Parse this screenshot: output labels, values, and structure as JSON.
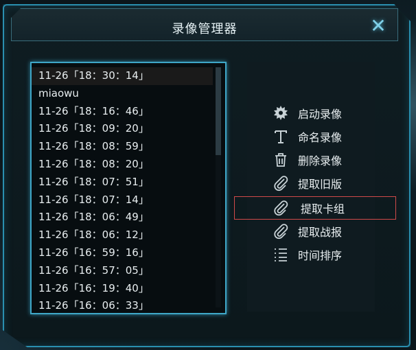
{
  "window": {
    "title": "录像管理器"
  },
  "list": {
    "items": [
      "11-26「18：30：14」",
      "miaowu",
      "11-26「18：16：46」",
      "11-26「18：09：20」",
      "11-26「18：08：59」",
      "11-26「18：08：20」",
      "11-26「18：07：51」",
      "11-26「18：07：14」",
      "11-26「18：06：49」",
      "11-26「18：06：12」",
      "11-26「16：59：16」",
      "11-26「16：57：05」",
      "11-26「16：19：40」",
      "11-26「16：06：33」"
    ],
    "selected_index": 0
  },
  "actions": [
    {
      "label": "启动录像",
      "icon": "gear-icon"
    },
    {
      "label": "命名录像",
      "icon": "text-icon"
    },
    {
      "label": "删除录像",
      "icon": "trash-icon"
    },
    {
      "label": "提取旧版",
      "icon": "paperclip-icon"
    },
    {
      "label": "提取卡组",
      "icon": "paperclip-icon"
    },
    {
      "label": "提取战报",
      "icon": "paperclip-icon"
    },
    {
      "label": "时间排序",
      "icon": "list-icon"
    }
  ],
  "highlighted_action_index": 4,
  "colors": {
    "accent": "#3fa7c8",
    "highlight": "#d24a4a",
    "text": "#e8eef0"
  }
}
